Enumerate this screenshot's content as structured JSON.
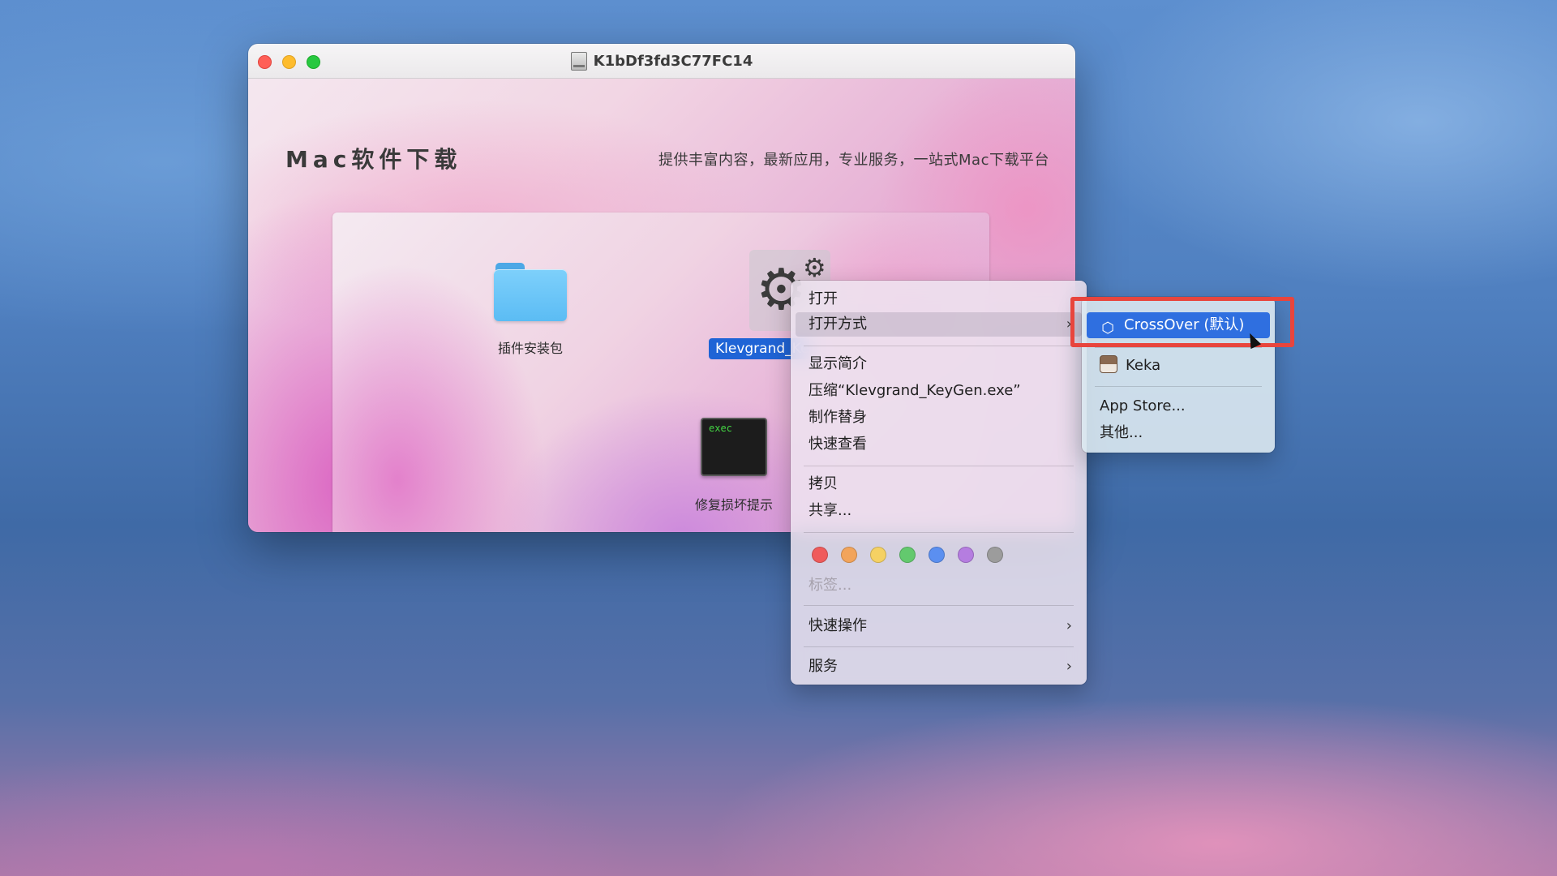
{
  "window": {
    "title": "K1bDf3fd3C77FC14",
    "brand": "Mac软件下载",
    "tagline": "提供丰富内容，最新应用，专业服务，一站式Mac下载平台"
  },
  "files": {
    "folder_label": "插件安装包",
    "exe_label": "Klevgrand_KeyGen.exe",
    "exec_label": "修复损坏提示",
    "exec_badge": "exec"
  },
  "context_menu": {
    "open": "打开",
    "open_with": "打开方式",
    "get_info": "显示简介",
    "compress": "压缩“Klevgrand_KeyGen.exe”",
    "make_alias": "制作替身",
    "quick_look": "快速查看",
    "copy": "拷贝",
    "share": "共享...",
    "tags_label": "标签...",
    "quick_actions": "快速操作",
    "services": "服务",
    "chevron": "›",
    "tag_colors": [
      "#ef5b5b",
      "#f2a45b",
      "#f5d163",
      "#63c96e",
      "#5b8ff0",
      "#b57de0",
      "#9c9c9c"
    ]
  },
  "open_with_submenu": {
    "crossover": "CrossOver (默认)",
    "keka": "Keka",
    "app_store": "App Store...",
    "other": "其他..."
  },
  "colors": {
    "selection": "#2f6fe0",
    "highlight": "#e8453d"
  }
}
